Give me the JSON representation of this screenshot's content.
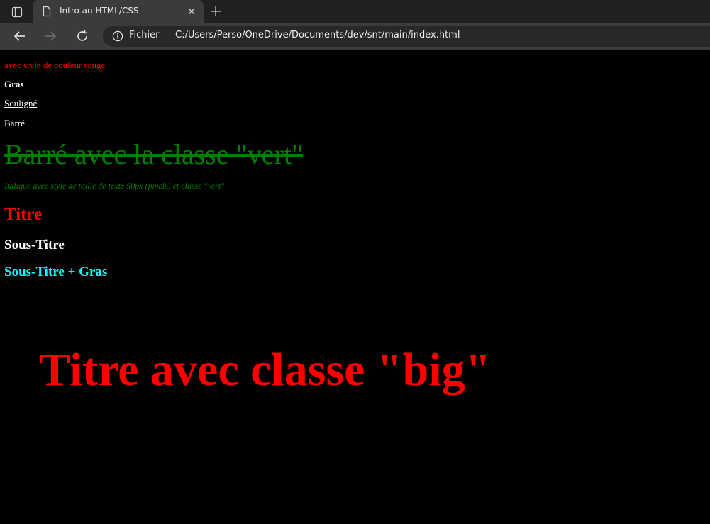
{
  "browser": {
    "tab": {
      "title": "Intro au HTML/CSS"
    },
    "address_bar": {
      "site_label": "Fichier",
      "url": "C:/Users/Perso/OneDrive/Documents/dev/snt/main/index.html"
    },
    "icons": {
      "tab_actions": "tab-actions-icon",
      "favicon": "page-icon",
      "close": "close-icon",
      "new_tab": "plus-icon",
      "back": "back-arrow-icon",
      "forward": "forward-arrow-icon",
      "refresh": "refresh-icon",
      "info": "info-icon"
    },
    "colors": {
      "tabstrip": "#202020",
      "toolbar": "#3b3b3b",
      "address_bar": "#282828"
    }
  },
  "page": {
    "red_text": "avec style de couleur rouge",
    "bold_text": "Gras",
    "underline_text": "Souligné",
    "strike_text": "Barré",
    "green_strike_text": "Barré avec la classe \"vert\"",
    "italic_text": "Italique avec style de taille de texte 50px (pixels) et classe \"vert\"",
    "title": "Titre",
    "subtitle": "Sous-Titre",
    "subtitle_bold": "Sous-Titre + Gras",
    "big_title": "Titre avec classe \"big\"",
    "colors": {
      "background": "#000000",
      "red": "#ff0000",
      "green": "#008000",
      "cyan": "#00ffff",
      "white": "#ffffff"
    }
  }
}
